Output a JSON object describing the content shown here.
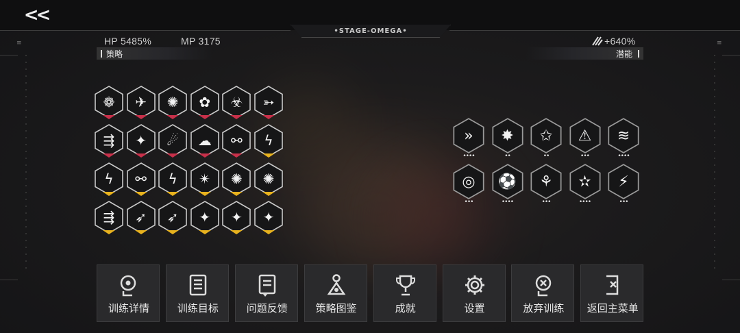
{
  "header": {
    "back_label": "<<",
    "stage_title": "•STAGE-OMEGA•",
    "hp": "HP 5485%",
    "mp": "MP 3175",
    "bonus": "+640%"
  },
  "sections": {
    "left_title": "策略",
    "right_title": "潜能"
  },
  "strategy_icons": [
    [
      "flower-burst-icon",
      "wings-icon",
      "vortex-icon",
      "blossom-icon",
      "biohazard-icon",
      "feather-wing-icon"
    ],
    [
      "arrow-volley-icon",
      "sparkle-icon",
      "comet-icon",
      "cloud-bolt-icon",
      "chain-nodes-icon",
      "lightning-icon"
    ],
    [
      "lightning-icon",
      "chain-nodes-icon",
      "lightning-icon",
      "shuriken-icon",
      "vortex-icon",
      "vortex-icon"
    ],
    [
      "arrow-volley-icon",
      "wing-arrows-icon",
      "wing-arrows-icon",
      "sparkle-icon",
      "sparkle-icon",
      "sparkle-icon"
    ]
  ],
  "strategy_ranks": [
    [
      "red",
      "red",
      "red",
      "red",
      "red",
      "red"
    ],
    [
      "red",
      "red",
      "red",
      "red",
      "red",
      "gold"
    ],
    [
      "gold",
      "gold",
      "gold",
      "gold",
      "gold",
      "gold"
    ],
    [
      "gold",
      "gold",
      "gold",
      "gold",
      "gold",
      "gold"
    ]
  ],
  "potential_icons": [
    [
      {
        "icon": "dash-icon",
        "dots": "••••"
      },
      {
        "icon": "shatter-icon",
        "dots": "••"
      },
      {
        "icon": "star-frame-icon",
        "dots": "••"
      },
      {
        "icon": "triangle-warning-icon",
        "dots": "•••"
      },
      {
        "icon": "speed-lines-icon",
        "dots": "••••"
      }
    ],
    [
      {
        "icon": "spiral-slash-icon",
        "dots": "•••"
      },
      {
        "icon": "ball-icon",
        "dots": "••••"
      },
      {
        "icon": "boot-icon",
        "dots": "•••"
      },
      {
        "icon": "triangle-star-icon",
        "dots": "••••"
      },
      {
        "icon": "running-figure-icon",
        "dots": "•••"
      }
    ]
  ],
  "menu": [
    {
      "label": "训练详情",
      "icon": "head-gear-icon"
    },
    {
      "label": "训练目标",
      "icon": "checklist-icon"
    },
    {
      "label": "问题反馈",
      "icon": "document-icon"
    },
    {
      "label": "策略图鉴",
      "icon": "codex-icon"
    },
    {
      "label": "成就",
      "icon": "trophy-icon"
    },
    {
      "label": "设置",
      "icon": "gear-icon"
    },
    {
      "label": "放弃训练",
      "icon": "head-x-icon"
    },
    {
      "label": "返回主菜单",
      "icon": "exit-icon"
    }
  ],
  "colors": {
    "red_rank": "#c8304a",
    "gold_rank": "#e8b21e",
    "hex_fill": "#161617",
    "hex_stroke": "#c9c9c9"
  }
}
